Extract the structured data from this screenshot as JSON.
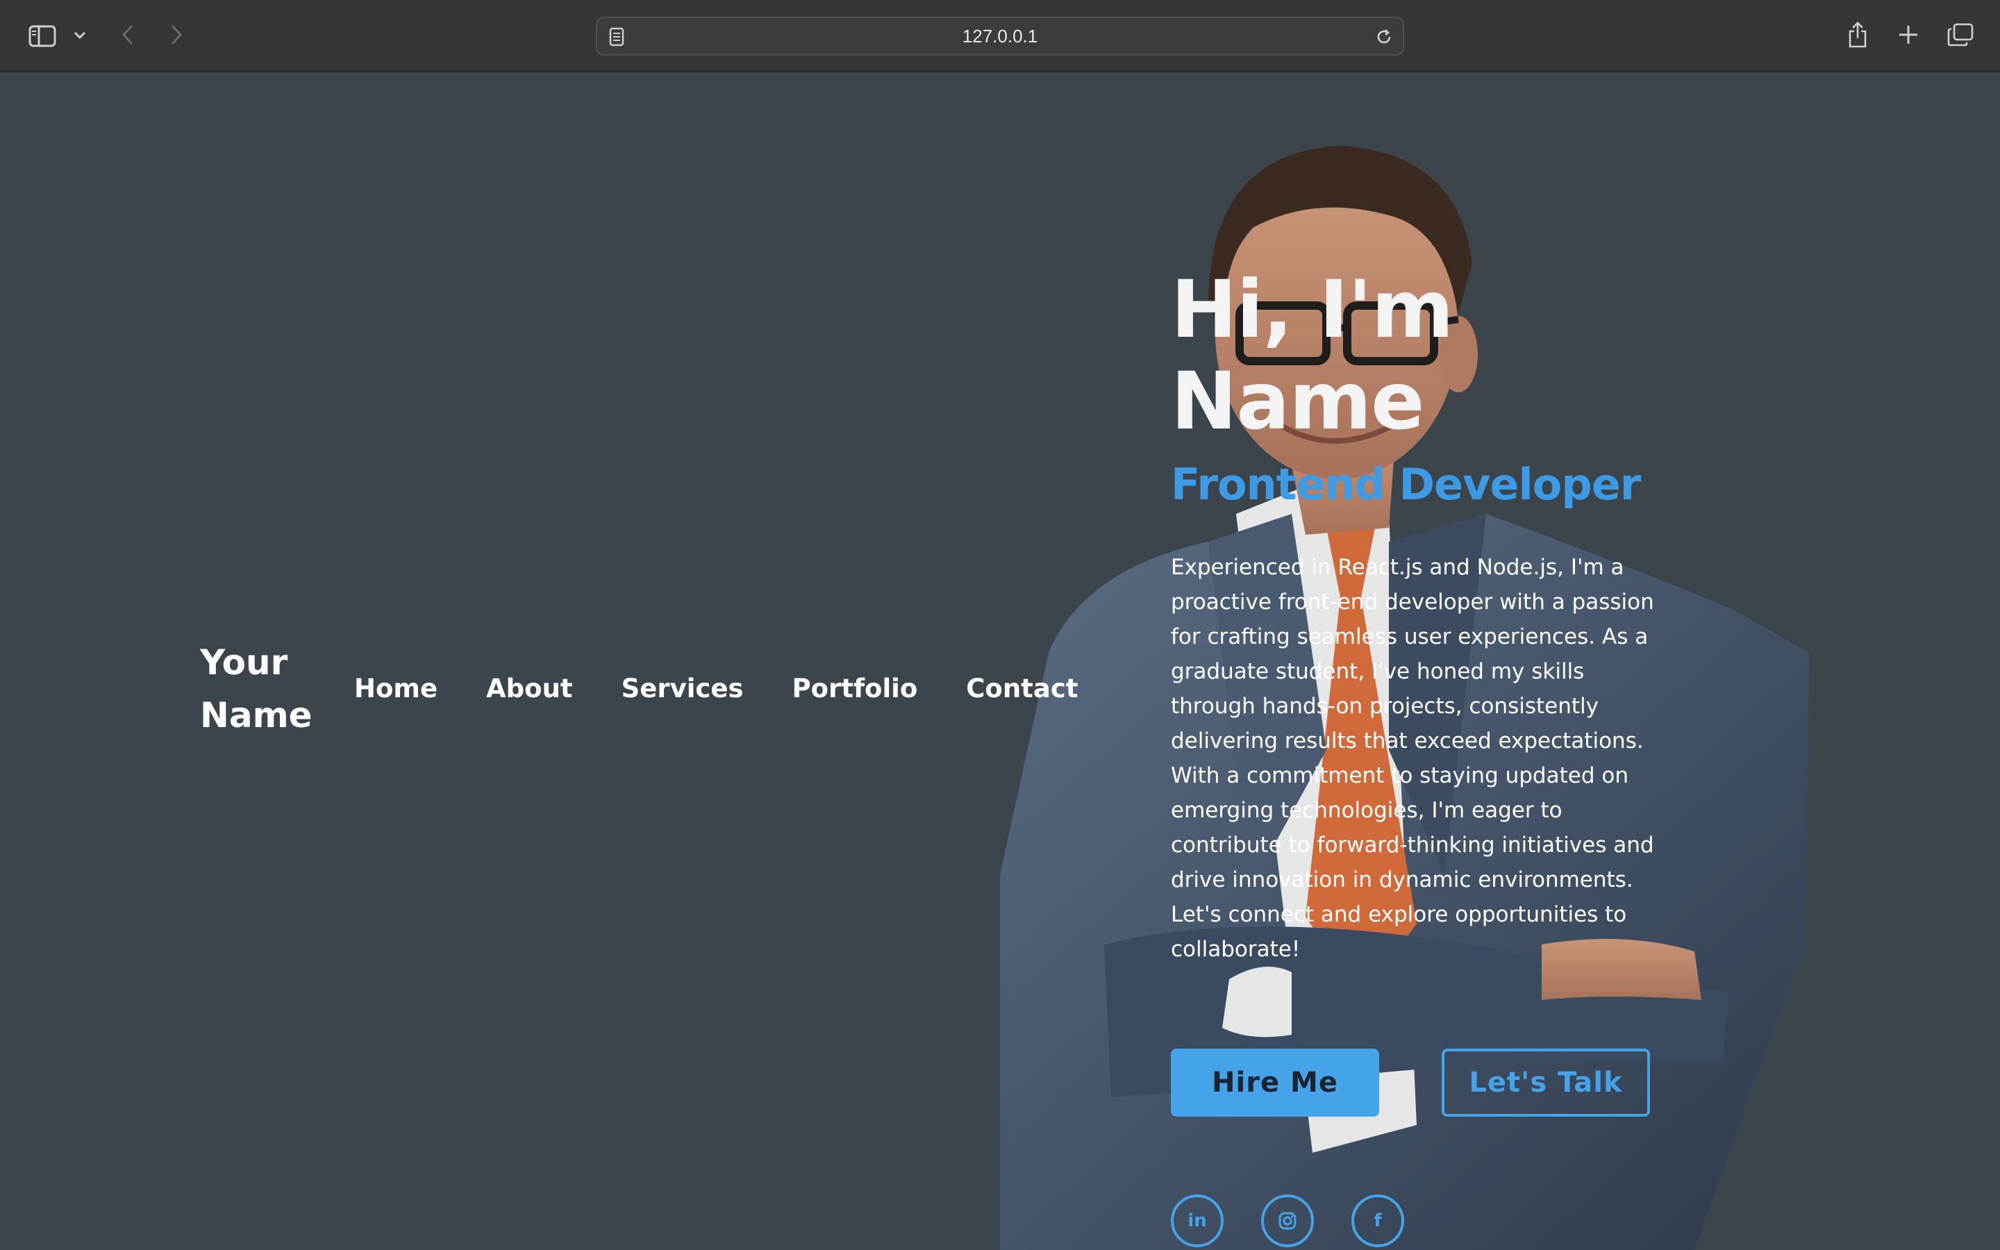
{
  "browser": {
    "url": "127.0.0.1",
    "icons": [
      "sidebar-icon",
      "chevron-down-icon",
      "back-icon",
      "forward-icon",
      "page-icon",
      "reload-icon",
      "share-icon",
      "new-tab-icon",
      "tabs-overview-icon"
    ]
  },
  "site": {
    "brand": "Your\nName",
    "nav": [
      "Home",
      "About",
      "Services",
      "Portfolio",
      "Contact"
    ]
  },
  "hero": {
    "heading": "Hi, I'm Name",
    "subheading": "Frontend Developer",
    "bio": "Experienced in React.js and Node.js, I'm a proactive front-end developer with a passion for crafting seamless user experiences. As a graduate student, I've honed my skills through hands-on projects, consistently delivering results that exceed expectations. With a commitment to staying updated on emerging technologies, I'm eager to contribute to forward-thinking initiatives and drive innovation in dynamic environments. Let's connect and explore opportunities to collaborate!",
    "primary_button": "Hire Me",
    "secondary_button": "Let's Talk",
    "social": [
      {
        "icon": "linkedin-icon",
        "label": "in"
      },
      {
        "icon": "instagram-icon",
        "label": ""
      },
      {
        "icon": "facebook-icon",
        "label": "f"
      }
    ]
  },
  "colors": {
    "background": "#3d454c",
    "accent": "#45a3ea",
    "toolbar": "#363636"
  }
}
